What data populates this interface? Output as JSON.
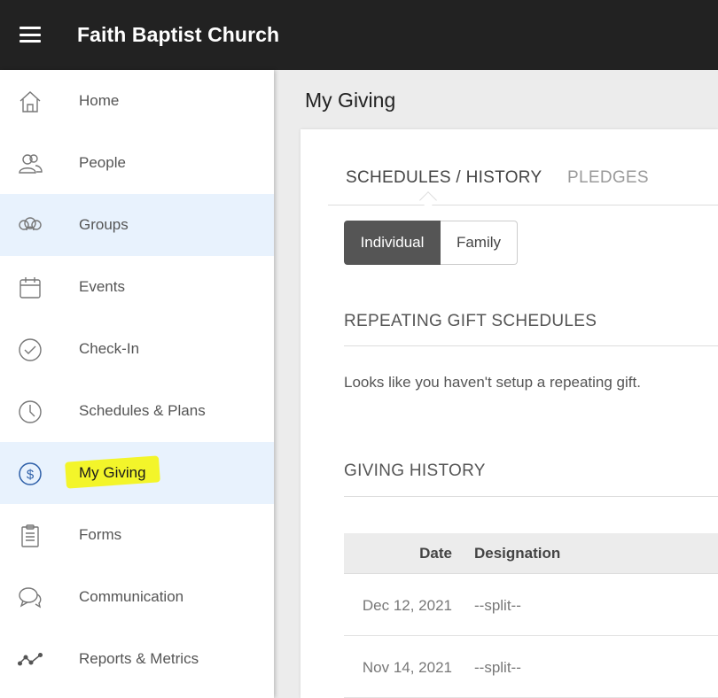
{
  "header": {
    "title": "Faith Baptist Church",
    "menu_icon": "hamburger-menu-icon"
  },
  "sidebar": {
    "items": [
      {
        "label": "Home",
        "icon": "home-icon",
        "active": false
      },
      {
        "label": "People",
        "icon": "people-icon",
        "active": false
      },
      {
        "label": "Groups",
        "icon": "groups-icon",
        "active": true
      },
      {
        "label": "Events",
        "icon": "calendar-icon",
        "active": false
      },
      {
        "label": "Check-In",
        "icon": "check-circle-icon",
        "active": false
      },
      {
        "label": "Schedules & Plans",
        "icon": "clock-icon",
        "active": false
      },
      {
        "label": "My Giving",
        "icon": "dollar-circle-icon",
        "active": true,
        "highlighted": true
      },
      {
        "label": "Forms",
        "icon": "clipboard-icon",
        "active": false
      },
      {
        "label": "Communication",
        "icon": "chat-bubbles-icon",
        "active": false
      },
      {
        "label": "Reports & Metrics",
        "icon": "line-graph-icon",
        "active": false
      }
    ]
  },
  "main": {
    "title": "My Giving",
    "tabs": [
      {
        "label": "SCHEDULES / HISTORY",
        "active": true
      },
      {
        "label": "PLEDGES",
        "active": false
      }
    ],
    "toggle": {
      "options": [
        "Individual",
        "Family"
      ],
      "selected": "Individual"
    },
    "repeating": {
      "title": "REPEATING GIFT SCHEDULES",
      "empty_message": "Looks like you haven't setup a repeating gift."
    },
    "history": {
      "title": "GIVING HISTORY",
      "columns": [
        "Date",
        "Designation"
      ],
      "rows": [
        {
          "date": "Dec 12, 2021",
          "designation": "--split--"
        },
        {
          "date": "Nov 14, 2021",
          "designation": "--split--"
        }
      ]
    }
  },
  "colors": {
    "topbar": "#222222",
    "active_nav": "#e8f2fd",
    "highlight": "#f3f52a",
    "toggle_on": "#555555"
  }
}
